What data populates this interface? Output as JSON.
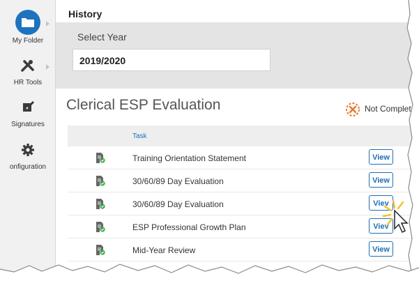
{
  "nav": {
    "items": [
      {
        "label": "My Folder",
        "icon": "folder-icon"
      },
      {
        "label": "HR Tools",
        "icon": "tools-icon"
      },
      {
        "label": "Signatures",
        "icon": "pen-icon"
      },
      {
        "label": "onfiguration",
        "icon": "gear-icon"
      }
    ]
  },
  "header": {
    "title": "History"
  },
  "year": {
    "label": "Select Year",
    "value": "2019/2020"
  },
  "evaluation": {
    "title": "Clerical ESP Evaluation",
    "status": "Not Complete"
  },
  "table": {
    "header": "Task",
    "rows": [
      {
        "task": "Training Orientation Statement",
        "action": "View"
      },
      {
        "task": "30/60/89 Day Evaluation",
        "action": "View"
      },
      {
        "task": "30/60/89 Day Evaluation",
        "action": "Viev"
      },
      {
        "task": "ESP Professional Growth Plan",
        "action": "Viev"
      },
      {
        "task": "Mid-Year Review",
        "action": "View"
      }
    ]
  },
  "colors": {
    "accent": "#1e6fb5",
    "folder": "#1e73be",
    "status": "#e8762b",
    "check": "#3aa34a"
  }
}
